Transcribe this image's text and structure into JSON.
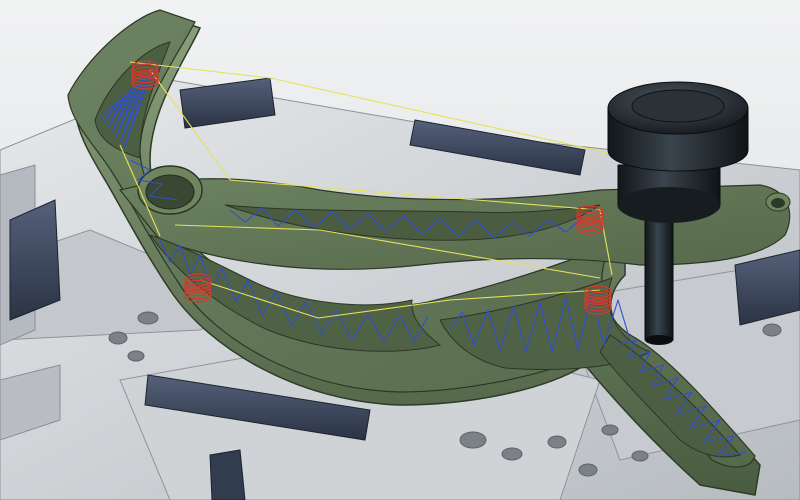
{
  "viewport": {
    "caption": "",
    "background_color": "#e9ebec",
    "part_color": "#5e7351",
    "part_shadow_color": "#3f4e36",
    "fixture_color": "#d6d9dc",
    "vise_jaw_color": "#3b4659",
    "toolpath_color": "#2f4fd0",
    "link_move_color": "#e6e25a",
    "drill_color": "#d23a2a",
    "tool_color": "#1d2226",
    "objects": [
      "machined-part",
      "fixture-plate",
      "vise-jaws",
      "pocket-toolpaths",
      "drill-toolpaths",
      "rapid-links",
      "cutting-tool"
    ]
  }
}
